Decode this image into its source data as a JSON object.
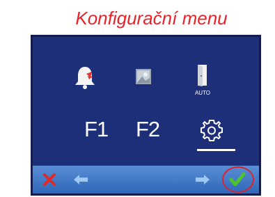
{
  "caption": "Konfigurační menu",
  "screen": {
    "icons": [
      {
        "name": "bell-icon"
      },
      {
        "name": "image-icon"
      },
      {
        "name": "door-icon",
        "label": "AUTO"
      }
    ],
    "function_keys": [
      "F1",
      "F2"
    ],
    "settings_icon": "gear-icon",
    "selected": "settings"
  },
  "bottom_bar": {
    "buttons": [
      "close-icon",
      "arrow-left-icon",
      "arrow-right-icon",
      "check-icon"
    ]
  },
  "colors": {
    "screen_bg": "#1e2f7a",
    "bar": "#3f78c9",
    "caption": "#e8232a",
    "highlight_ring": "#d9242c"
  }
}
